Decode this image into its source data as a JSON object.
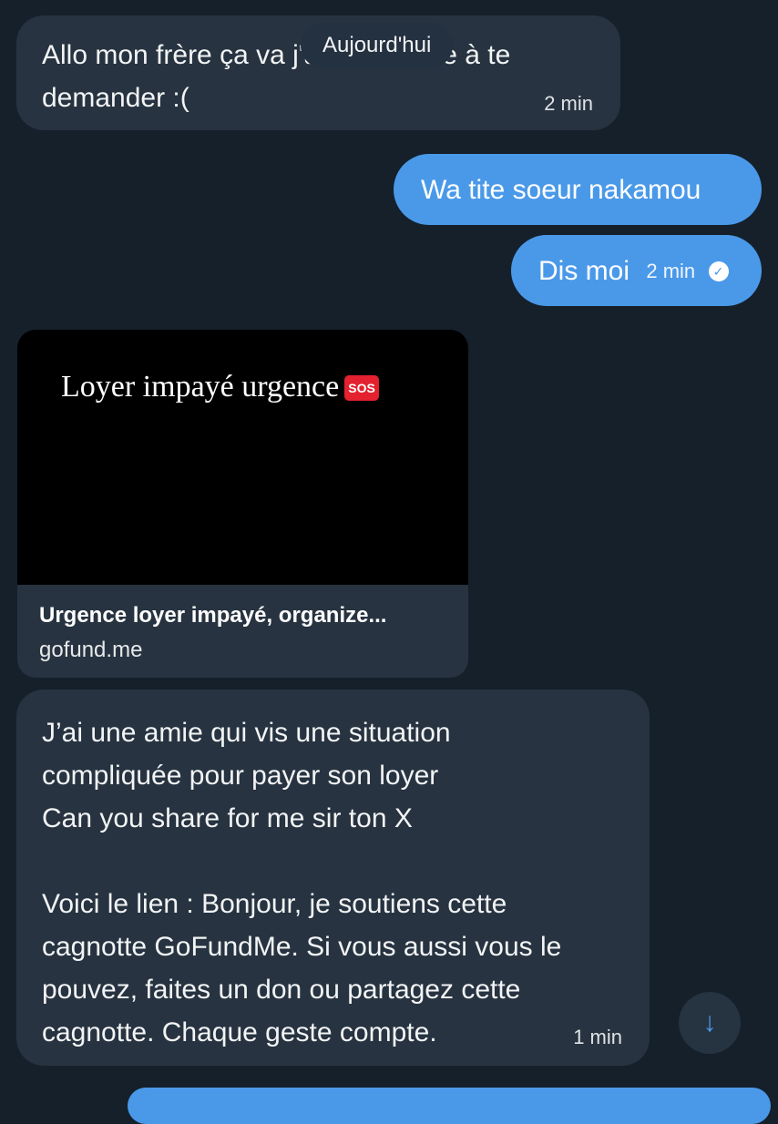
{
  "date_separator": "Aujourd'hui",
  "messages": [
    {
      "direction": "incoming",
      "text": "Allo mon frère ça va j'ai un service à te demander :(",
      "time": "2 min"
    },
    {
      "direction": "outgoing",
      "text": "Wa tite soeur nakamou"
    },
    {
      "direction": "outgoing",
      "text": "Dis moi",
      "time": "2 min",
      "status_icon": "check-circle-icon"
    },
    {
      "direction": "incoming",
      "lines": [
        "J’ai une amie qui vis une situation",
        "compliquée pour payer son loyer",
        "Can you share for me sir ton X",
        "",
        "Voici le lien : Bonjour, je soutiens cette",
        "cagnotte GoFundMe. Si vous aussi vous le",
        "pouvez, faites un don ou partagez cette",
        "cagnotte. Chaque geste compte."
      ],
      "time": "1 min"
    }
  ],
  "link_preview": {
    "image_text": "Loyer impayé urgence",
    "image_badge": "SOS",
    "title": "Urgence loyer impayé, organize...",
    "domain": "gofund.me"
  },
  "scroll_button_icon": "arrow-down-icon",
  "colors": {
    "background": "#15202b",
    "incoming_bubble": "#273340",
    "outgoing_bubble": "#4a99e9"
  }
}
